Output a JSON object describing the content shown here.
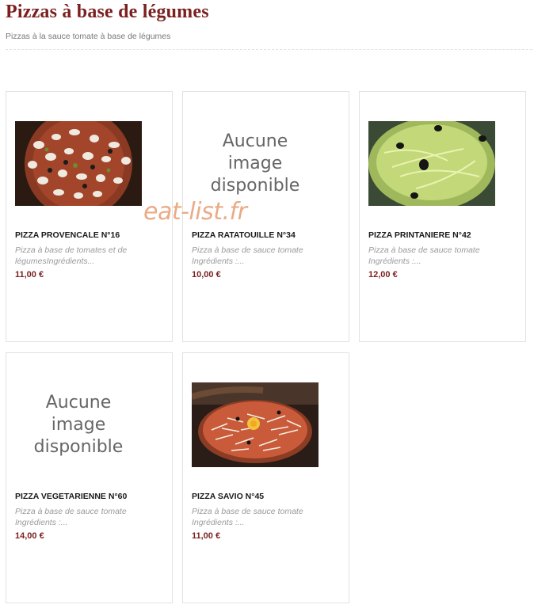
{
  "header": {
    "title": "Pizzas à base de légumes",
    "subtitle": "Pizzas à la sauce tomate à base de légumes"
  },
  "watermark": "eat-list.fr",
  "products": [
    {
      "name": "PIZZA PROVENCALE N°16",
      "description": "Pizza à base de tomates et de légumesIngrédients...",
      "price": "11,00 €",
      "image": "photo"
    },
    {
      "name": "PIZZA RATATOUILLE N°34",
      "description": "Pizza à base de sauce tomate Ingrédients :...",
      "price": "10,00 €",
      "image_text": "Aucune\nimage\ndisponible"
    },
    {
      "name": "PIZZA PRINTANIERE N°42",
      "description": "Pizza à base de sauce tomate Ingrédients :...",
      "price": "12,00 €",
      "image": "photo"
    },
    {
      "name": "PIZZA VEGETARIENNE N°60",
      "description": "Pizza à base de sauce tomate Ingrédients :...",
      "price": "14,00 €",
      "image_text": "Aucune\nimage\ndisponible"
    },
    {
      "name": "PIZZA SAVIO N°45",
      "description": "Pizza à base de sauce tomate Ingrédients :...",
      "price": "11,00 €",
      "image": "photo"
    }
  ]
}
